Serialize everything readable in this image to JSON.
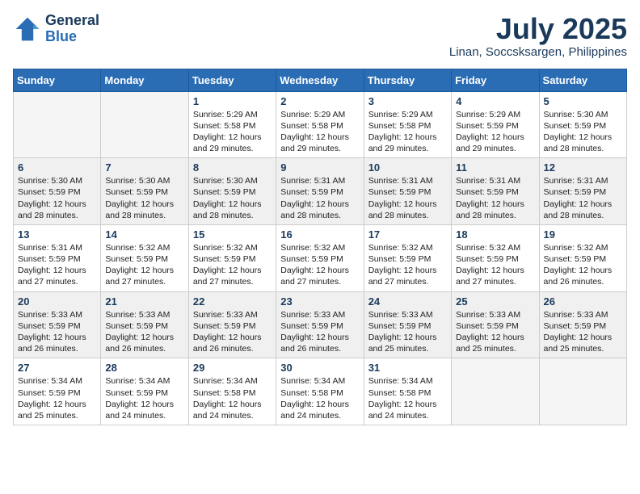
{
  "header": {
    "logo_line1": "General",
    "logo_line2": "Blue",
    "month_title": "July 2025",
    "location": "Linan, Soccsksargen, Philippines"
  },
  "weekdays": [
    "Sunday",
    "Monday",
    "Tuesday",
    "Wednesday",
    "Thursday",
    "Friday",
    "Saturday"
  ],
  "weeks": [
    [
      {
        "day": "",
        "info": ""
      },
      {
        "day": "",
        "info": ""
      },
      {
        "day": "1",
        "info": "Sunrise: 5:29 AM\nSunset: 5:58 PM\nDaylight: 12 hours and 29 minutes."
      },
      {
        "day": "2",
        "info": "Sunrise: 5:29 AM\nSunset: 5:58 PM\nDaylight: 12 hours and 29 minutes."
      },
      {
        "day": "3",
        "info": "Sunrise: 5:29 AM\nSunset: 5:58 PM\nDaylight: 12 hours and 29 minutes."
      },
      {
        "day": "4",
        "info": "Sunrise: 5:29 AM\nSunset: 5:59 PM\nDaylight: 12 hours and 29 minutes."
      },
      {
        "day": "5",
        "info": "Sunrise: 5:30 AM\nSunset: 5:59 PM\nDaylight: 12 hours and 28 minutes."
      }
    ],
    [
      {
        "day": "6",
        "info": "Sunrise: 5:30 AM\nSunset: 5:59 PM\nDaylight: 12 hours and 28 minutes."
      },
      {
        "day": "7",
        "info": "Sunrise: 5:30 AM\nSunset: 5:59 PM\nDaylight: 12 hours and 28 minutes."
      },
      {
        "day": "8",
        "info": "Sunrise: 5:30 AM\nSunset: 5:59 PM\nDaylight: 12 hours and 28 minutes."
      },
      {
        "day": "9",
        "info": "Sunrise: 5:31 AM\nSunset: 5:59 PM\nDaylight: 12 hours and 28 minutes."
      },
      {
        "day": "10",
        "info": "Sunrise: 5:31 AM\nSunset: 5:59 PM\nDaylight: 12 hours and 28 minutes."
      },
      {
        "day": "11",
        "info": "Sunrise: 5:31 AM\nSunset: 5:59 PM\nDaylight: 12 hours and 28 minutes."
      },
      {
        "day": "12",
        "info": "Sunrise: 5:31 AM\nSunset: 5:59 PM\nDaylight: 12 hours and 28 minutes."
      }
    ],
    [
      {
        "day": "13",
        "info": "Sunrise: 5:31 AM\nSunset: 5:59 PM\nDaylight: 12 hours and 27 minutes."
      },
      {
        "day": "14",
        "info": "Sunrise: 5:32 AM\nSunset: 5:59 PM\nDaylight: 12 hours and 27 minutes."
      },
      {
        "day": "15",
        "info": "Sunrise: 5:32 AM\nSunset: 5:59 PM\nDaylight: 12 hours and 27 minutes."
      },
      {
        "day": "16",
        "info": "Sunrise: 5:32 AM\nSunset: 5:59 PM\nDaylight: 12 hours and 27 minutes."
      },
      {
        "day": "17",
        "info": "Sunrise: 5:32 AM\nSunset: 5:59 PM\nDaylight: 12 hours and 27 minutes."
      },
      {
        "day": "18",
        "info": "Sunrise: 5:32 AM\nSunset: 5:59 PM\nDaylight: 12 hours and 27 minutes."
      },
      {
        "day": "19",
        "info": "Sunrise: 5:32 AM\nSunset: 5:59 PM\nDaylight: 12 hours and 26 minutes."
      }
    ],
    [
      {
        "day": "20",
        "info": "Sunrise: 5:33 AM\nSunset: 5:59 PM\nDaylight: 12 hours and 26 minutes."
      },
      {
        "day": "21",
        "info": "Sunrise: 5:33 AM\nSunset: 5:59 PM\nDaylight: 12 hours and 26 minutes."
      },
      {
        "day": "22",
        "info": "Sunrise: 5:33 AM\nSunset: 5:59 PM\nDaylight: 12 hours and 26 minutes."
      },
      {
        "day": "23",
        "info": "Sunrise: 5:33 AM\nSunset: 5:59 PM\nDaylight: 12 hours and 26 minutes."
      },
      {
        "day": "24",
        "info": "Sunrise: 5:33 AM\nSunset: 5:59 PM\nDaylight: 12 hours and 25 minutes."
      },
      {
        "day": "25",
        "info": "Sunrise: 5:33 AM\nSunset: 5:59 PM\nDaylight: 12 hours and 25 minutes."
      },
      {
        "day": "26",
        "info": "Sunrise: 5:33 AM\nSunset: 5:59 PM\nDaylight: 12 hours and 25 minutes."
      }
    ],
    [
      {
        "day": "27",
        "info": "Sunrise: 5:34 AM\nSunset: 5:59 PM\nDaylight: 12 hours and 25 minutes."
      },
      {
        "day": "28",
        "info": "Sunrise: 5:34 AM\nSunset: 5:59 PM\nDaylight: 12 hours and 24 minutes."
      },
      {
        "day": "29",
        "info": "Sunrise: 5:34 AM\nSunset: 5:58 PM\nDaylight: 12 hours and 24 minutes."
      },
      {
        "day": "30",
        "info": "Sunrise: 5:34 AM\nSunset: 5:58 PM\nDaylight: 12 hours and 24 minutes."
      },
      {
        "day": "31",
        "info": "Sunrise: 5:34 AM\nSunset: 5:58 PM\nDaylight: 12 hours and 24 minutes."
      },
      {
        "day": "",
        "info": ""
      },
      {
        "day": "",
        "info": ""
      }
    ]
  ]
}
